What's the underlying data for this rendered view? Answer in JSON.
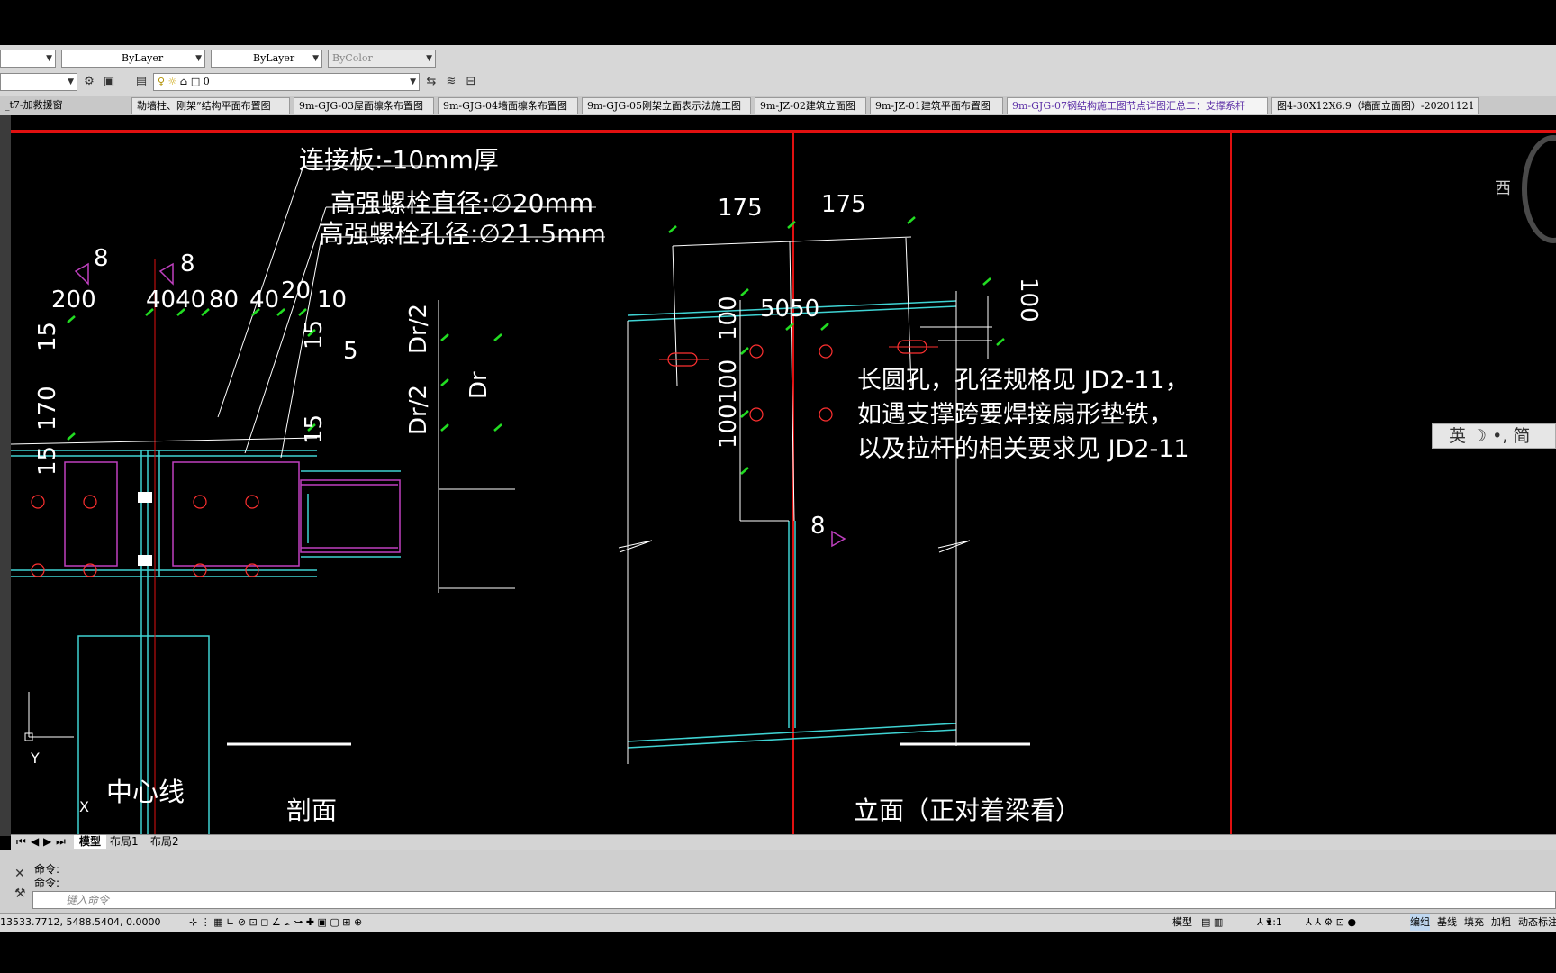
{
  "toolbar": {
    "linetype_value": "ByLayer",
    "lineweight_value": "ByLayer",
    "plotstyle_value": "ByColor",
    "layer_value": "0"
  },
  "file_tabs": [
    {
      "label": "_t7-加救援窗"
    },
    {
      "label": "勒墙柱、刚架”结构平面布置图"
    },
    {
      "label": "9m-GJG-03屋面檩条布置图"
    },
    {
      "label": "9m-GJG-04墙面檩条布置图"
    },
    {
      "label": "9m-GJG-05刚架立面表示法施工图"
    },
    {
      "label": "9m-JZ-02建筑立面图"
    },
    {
      "label": "9m-JZ-01建筑平面布置图"
    },
    {
      "label": "9m-GJG-07钢结构施工图节点详图汇总二：支撑系杆"
    },
    {
      "label": "图4-30X12X6.9（墙面立面图）-20201121"
    }
  ],
  "drawing": {
    "notes": {
      "plate": "连接板:-10mm厚",
      "bolt_dia": "高强螺栓直径:∅20mm",
      "hole_dia": "高强螺栓孔径:∅21.5mm",
      "slot_note_1": "长圆孔，孔径规格见 JD2-11，",
      "slot_note_2": "如遇支撑跨要焊接扇形垫铁，",
      "slot_note_3": "以及拉杆的相关要求见 JD2-11"
    },
    "dims": {
      "d200": "200",
      "d4040": "4040",
      "d80": "80",
      "d40": "40",
      "d20": "20",
      "d10": "10",
      "w8a": "8",
      "w8b": "8",
      "w8c": "8",
      "w5": "5",
      "v15a": "15",
      "v170": "170",
      "v15b": "15",
      "v15c": "15",
      "v15d": "15",
      "dr2a": "Dr/2",
      "dr2b": "Dr/2",
      "dr": "Dr",
      "d175a": "175",
      "d175b": "175",
      "d5050": "5050",
      "d100a": "100",
      "d100b": "100",
      "d100100": "100100"
    },
    "labels": {
      "section": "剖面",
      "elevation": "立面（正对着梁看）",
      "centerline": "中心线",
      "axis_y": "Y",
      "axis_x": "X"
    }
  },
  "viewcube": {
    "west": "西"
  },
  "ime": {
    "text": "英 ☽ •, 简"
  },
  "layout_tabs": [
    {
      "label": "模型"
    },
    {
      "label": "布局1"
    },
    {
      "label": "布局2"
    }
  ],
  "command": {
    "history_1": "命令:",
    "history_2": "命令:",
    "placeholder": "键入命令"
  },
  "status": {
    "coords": "13533.7712,  5488.5404,  0.0000",
    "model": "模型",
    "scale": "1:1",
    "toggles": [
      "编组",
      "基线",
      "填充",
      "加粗",
      "动态标注"
    ]
  },
  "colors": {
    "cyan": "#3fd3d3",
    "magenta": "#c040c0",
    "red": "#e01010",
    "green": "#22dd22",
    "white": "#ffffff"
  }
}
